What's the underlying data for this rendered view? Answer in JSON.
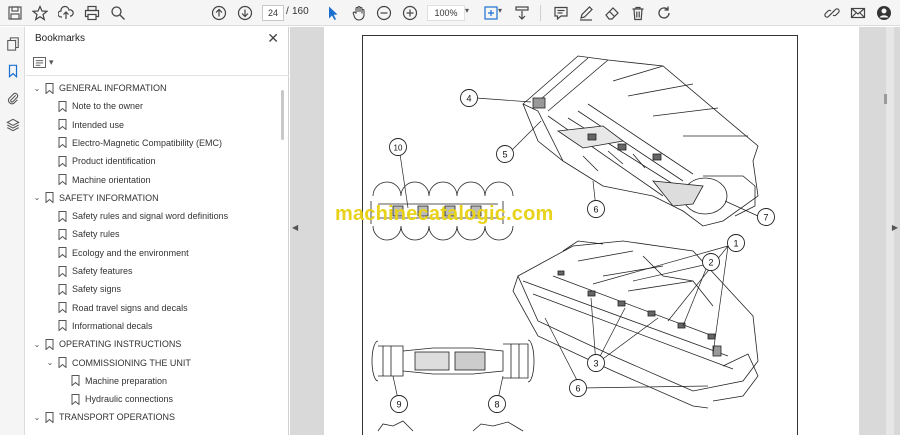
{
  "toolbar": {
    "current_page": "24",
    "page_separator": "/",
    "total_pages": "160",
    "zoom": "100%"
  },
  "panel": {
    "title": "Bookmarks",
    "close_glyph": "✕",
    "options_caret": "▾"
  },
  "bookmarks": [
    {
      "label": "GENERAL INFORMATION",
      "level": 0,
      "expanded": true
    },
    {
      "label": "Note to the owner",
      "level": 1
    },
    {
      "label": "Intended use",
      "level": 1
    },
    {
      "label": "Electro-Magnetic Compatibility (EMC)",
      "level": 1
    },
    {
      "label": "Product identification",
      "level": 1
    },
    {
      "label": "Machine orientation",
      "level": 1
    },
    {
      "label": "SAFETY INFORMATION",
      "level": 0,
      "expanded": true
    },
    {
      "label": "Safety rules and signal word definitions",
      "level": 1
    },
    {
      "label": "Safety rules",
      "level": 1
    },
    {
      "label": "Ecology and the environment",
      "level": 1
    },
    {
      "label": "Safety features",
      "level": 1
    },
    {
      "label": "Safety signs",
      "level": 1
    },
    {
      "label": "Road travel signs and decals",
      "level": 1
    },
    {
      "label": "Informational decals",
      "level": 1
    },
    {
      "label": "OPERATING INSTRUCTIONS",
      "level": 0,
      "expanded": true
    },
    {
      "label": "COMMISSIONING THE UNIT",
      "level": 1,
      "expanded": true
    },
    {
      "label": "Machine preparation",
      "level": 2
    },
    {
      "label": "Hydraulic connections",
      "level": 2
    },
    {
      "label": "TRANSPORT OPERATIONS",
      "level": 0,
      "expanded": true
    }
  ],
  "document": {
    "watermark": "machinecatalogic.com",
    "callouts": [
      "1",
      "2",
      "3",
      "3",
      "3",
      "4",
      "5",
      "6",
      "6",
      "6",
      "7",
      "8",
      "9",
      "10"
    ]
  },
  "icons": {
    "save": "save-icon",
    "star": "star-icon",
    "upload": "upload-icon",
    "print": "print-icon",
    "zoom": "zoom-icon",
    "prev": "prev-page-icon",
    "next": "next-page-icon",
    "select": "select-cursor-icon",
    "hand": "hand-icon",
    "zoom_out": "zoom-out-icon",
    "zoom_in": "zoom-in-icon",
    "fit": "fit-page-icon",
    "scroll": "scroll-mode-icon",
    "comment": "comment-icon",
    "pen": "pen-icon",
    "eraser": "eraser-icon",
    "delete": "delete-icon",
    "rotate": "rotate-icon",
    "link": "link-icon",
    "mail": "mail-icon",
    "account": "account-icon"
  },
  "colors": {
    "watermark": "#e8d21a",
    "accent_blue": "#1a6fd1"
  }
}
